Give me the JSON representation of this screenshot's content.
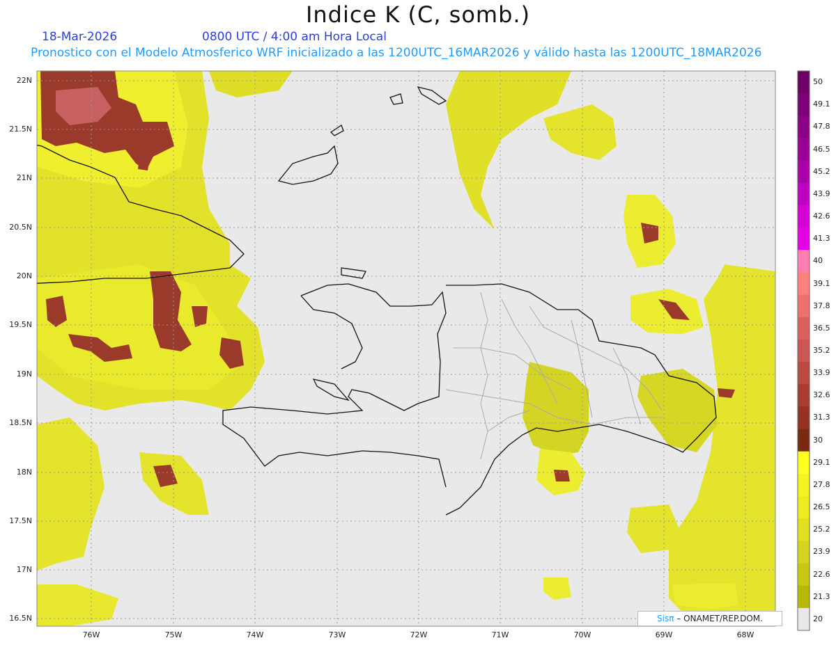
{
  "header": {
    "title": "Indice K (C, somb.)",
    "date": "18-Mar-2026",
    "time": "0800 UTC / 4:00 am Hora Local",
    "description": "Pronostico con el Modelo Atmosferico WRF inicializado a las 1200UTC_16MAR2026 y válido hasta las  1200UTC_18MAR2026"
  },
  "axes": {
    "lat_labels": [
      "22N",
      "21.5N",
      "21N",
      "20.5N",
      "20N",
      "19.5N",
      "19N",
      "18.5N",
      "18N",
      "17.5N",
      "17N",
      "16.5N"
    ],
    "lon_labels": [
      "76W",
      "75W",
      "74W",
      "73W",
      "72W",
      "71W",
      "70W",
      "69W",
      "68W"
    ]
  },
  "colorbar": {
    "labels": [
      "50",
      "49.1",
      "47.8",
      "46.5",
      "45.2",
      "43.9",
      "42.6",
      "41.3",
      "40",
      "39.1",
      "37.8",
      "36.5",
      "35.2",
      "33.9",
      "32.6",
      "31.3",
      "30",
      "29.1",
      "27.8",
      "26.5",
      "25.2",
      "23.9",
      "22.6",
      "21.3",
      "20"
    ],
    "colors": [
      "#6e0066",
      "#7c0078",
      "#8c0088",
      "#9a0098",
      "#aa00aa",
      "#c000c0",
      "#d400d4",
      "#e600e6",
      "#ff80b0",
      "#ff8080",
      "#ee7070",
      "#dd6060",
      "#cc5555",
      "#bb4a40",
      "#a83c30",
      "#963222",
      "#7a2a10",
      "#ffff20",
      "#f4f420",
      "#ecec20",
      "#e0e020",
      "#d4d420",
      "#c8c810",
      "#b8b808",
      "#e9e9e9"
    ]
  },
  "credit": {
    "sis": "Sisπ",
    "rest": " – ONAMET/REP.DOM."
  }
}
